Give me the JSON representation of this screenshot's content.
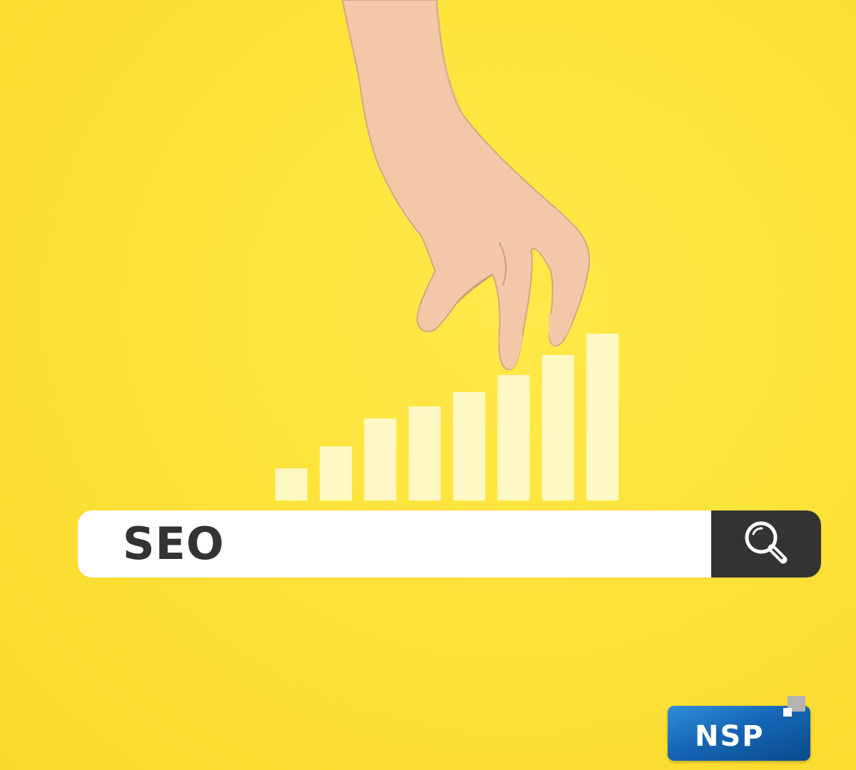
{
  "search": {
    "query": "SEO",
    "button_icon": "search-icon"
  },
  "chart_data": {
    "type": "bar",
    "categories": [
      "",
      "",
      "",
      "",
      "",
      "",
      "",
      ""
    ],
    "values": [
      45,
      76,
      115,
      132,
      152,
      176,
      204,
      234
    ],
    "bar_color": "#fef8c4"
  },
  "logo": {
    "text": "NSP",
    "color": "#1566b4"
  },
  "colors": {
    "background": "#fde33a",
    "search_bar": "#ffffff",
    "search_button": "#333333",
    "text": "#333333"
  }
}
